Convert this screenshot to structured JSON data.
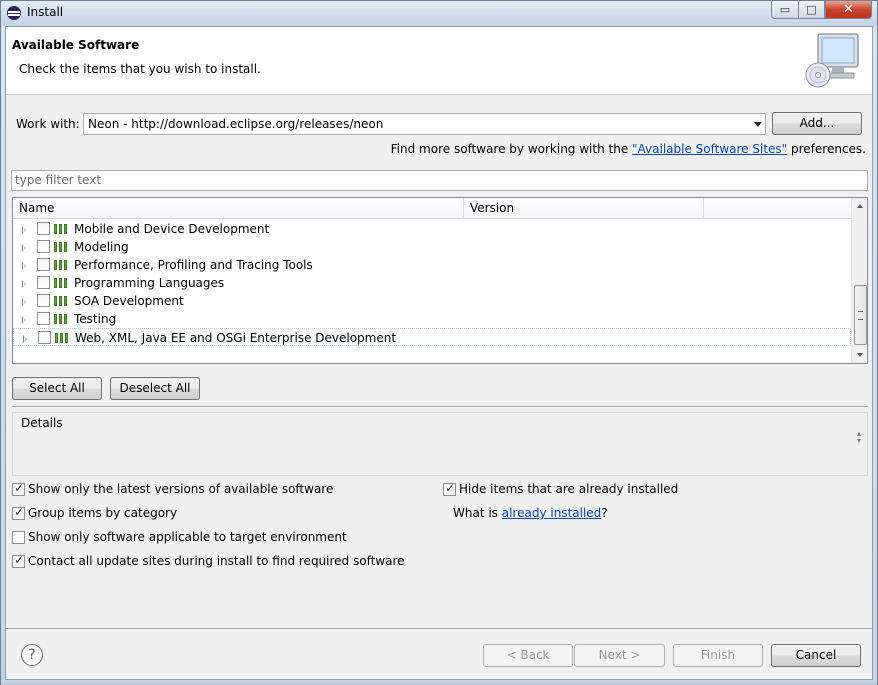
{
  "window": {
    "title": "Install",
    "controls": {
      "minimize": "▭",
      "maximize": "□",
      "close": "✕"
    }
  },
  "banner": {
    "title": "Available Software",
    "description": "Check the items that you wish to install."
  },
  "work_with": {
    "label": "Work with:",
    "value": "Neon - http://download.eclipse.org/releases/neon",
    "add_button": "Add...",
    "find_more_prefix": "Find more software by working with the ",
    "find_more_link": "\"Available Software Sites\"",
    "find_more_suffix": " preferences."
  },
  "filter": {
    "placeholder": "type filter text"
  },
  "tree": {
    "columns": [
      "Name",
      "Version",
      ""
    ],
    "rows": [
      {
        "label": "Mobile and Device Development",
        "checked": false
      },
      {
        "label": "Modeling",
        "checked": false
      },
      {
        "label": "Performance, Profiling and Tracing Tools",
        "checked": false
      },
      {
        "label": "Programming Languages",
        "checked": false
      },
      {
        "label": "SOA Development",
        "checked": false
      },
      {
        "label": "Testing",
        "checked": false
      },
      {
        "label": "Web, XML, Java EE and OSGi Enterprise Development",
        "checked": false
      }
    ]
  },
  "selection_buttons": {
    "select_all": "Select All",
    "deselect_all": "Deselect All"
  },
  "details": {
    "label": "Details"
  },
  "options": {
    "latest_versions": {
      "label": "Show only the latest versions of available software",
      "checked": true
    },
    "group_by_category": {
      "label": "Group items by category",
      "checked": true
    },
    "target_env": {
      "label": "Show only software applicable to target environment",
      "checked": false
    },
    "contact_sites": {
      "label": "Contact all update sites during install to find required software",
      "checked": true
    },
    "hide_installed": {
      "label": "Hide items that are already installed",
      "checked": true
    },
    "what_is_prefix": "What is ",
    "what_is_link": "already installed",
    "what_is_suffix": "?"
  },
  "footer": {
    "help": "?",
    "back": "< Back",
    "next": "Next >",
    "finish": "Finish",
    "cancel": "Cancel"
  },
  "colors": {
    "link": "#0645ad",
    "category_icon": "#6fa14a"
  }
}
